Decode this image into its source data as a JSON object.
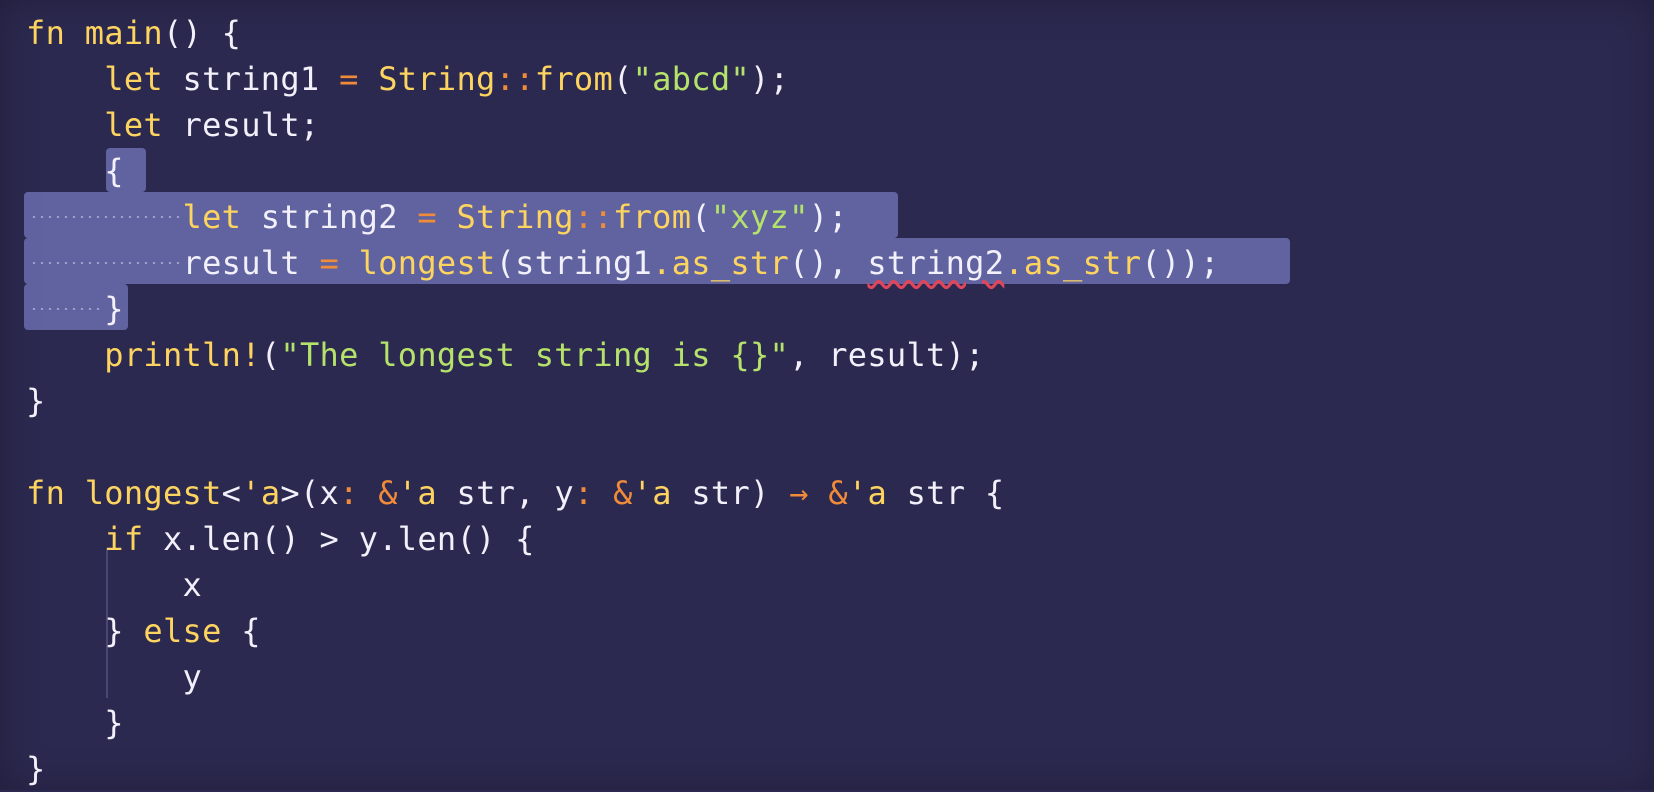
{
  "editor": {
    "theme": {
      "background": "#2c2950",
      "keyword": "#fdd45f",
      "string": "#b5e26b",
      "operator": "#f08b3a",
      "text": "#f2f0fa",
      "selection": "#6f73b6",
      "error_underline": "#e0465b"
    },
    "lines": [
      {
        "tokens": [
          {
            "t": "fn",
            "c": "kw"
          },
          {
            "t": " main",
            "c": "fn"
          },
          {
            "t": "() {",
            "c": "punc"
          }
        ]
      },
      {
        "tokens": [
          {
            "t": "    let",
            "c": "kw"
          },
          {
            "t": " string1 ",
            "c": "plain"
          },
          {
            "t": "=",
            "c": "op"
          },
          {
            "t": " String",
            "c": "ty"
          },
          {
            "t": "::",
            "c": "op"
          },
          {
            "t": "from",
            "c": "fn"
          },
          {
            "t": "(",
            "c": "punc"
          },
          {
            "t": "\"abcd\"",
            "c": "str"
          },
          {
            "t": ");",
            "c": "punc"
          }
        ]
      },
      {
        "tokens": [
          {
            "t": "    let",
            "c": "kw"
          },
          {
            "t": " result;",
            "c": "plain"
          }
        ]
      },
      {
        "tokens": [
          {
            "t": "    {",
            "c": "punc"
          }
        ]
      },
      {
        "tokens": [
          {
            "t": "        let",
            "c": "kw"
          },
          {
            "t": " string2 ",
            "c": "plain"
          },
          {
            "t": "=",
            "c": "op"
          },
          {
            "t": " String",
            "c": "ty"
          },
          {
            "t": "::",
            "c": "op"
          },
          {
            "t": "from",
            "c": "fn"
          },
          {
            "t": "(",
            "c": "punc"
          },
          {
            "t": "\"xyz\"",
            "c": "str"
          },
          {
            "t": ");",
            "c": "punc"
          }
        ]
      },
      {
        "tokens": [
          {
            "t": "        result ",
            "c": "plain"
          },
          {
            "t": "=",
            "c": "op"
          },
          {
            "t": " longest",
            "c": "fn"
          },
          {
            "t": "(string1",
            "c": "plain"
          },
          {
            "t": ".as_str",
            "c": "fn"
          },
          {
            "t": "(), ",
            "c": "punc"
          },
          {
            "t": "string2",
            "c": "err"
          },
          {
            "t": ".as_str",
            "c": "fn"
          },
          {
            "t": "());",
            "c": "punc"
          }
        ]
      },
      {
        "tokens": [
          {
            "t": "    }",
            "c": "punc"
          }
        ]
      },
      {
        "tokens": [
          {
            "t": "    println!",
            "c": "fn"
          },
          {
            "t": "(",
            "c": "punc"
          },
          {
            "t": "\"The longest string is {}\"",
            "c": "str"
          },
          {
            "t": ", result);",
            "c": "punc"
          }
        ]
      },
      {
        "tokens": [
          {
            "t": "}",
            "c": "punc"
          }
        ]
      },
      {
        "tokens": []
      },
      {
        "tokens": [
          {
            "t": "fn",
            "c": "kw"
          },
          {
            "t": " longest",
            "c": "fn"
          },
          {
            "t": "<",
            "c": "punc"
          },
          {
            "t": "'a",
            "c": "ty"
          },
          {
            "t": ">(x",
            "c": "plain"
          },
          {
            "t": ":",
            "c": "op"
          },
          {
            "t": " &",
            "c": "op"
          },
          {
            "t": "'a",
            "c": "ty"
          },
          {
            "t": " str, y",
            "c": "plain"
          },
          {
            "t": ":",
            "c": "op"
          },
          {
            "t": " &",
            "c": "op"
          },
          {
            "t": "'a",
            "c": "ty"
          },
          {
            "t": " str) ",
            "c": "plain"
          },
          {
            "t": "→",
            "c": "op"
          },
          {
            "t": " &",
            "c": "op"
          },
          {
            "t": "'a",
            "c": "ty"
          },
          {
            "t": " str {",
            "c": "plain"
          }
        ]
      },
      {
        "tokens": [
          {
            "t": "    if",
            "c": "kw"
          },
          {
            "t": " x.len() > y.len() {",
            "c": "plain"
          }
        ]
      },
      {
        "tokens": [
          {
            "t": "        x",
            "c": "plain"
          }
        ]
      },
      {
        "tokens": [
          {
            "t": "    }",
            "c": "punc"
          },
          {
            "t": " else",
            "c": "kw"
          },
          {
            "t": " {",
            "c": "punc"
          }
        ]
      },
      {
        "tokens": [
          {
            "t": "        y",
            "c": "plain"
          }
        ]
      },
      {
        "tokens": [
          {
            "t": "    }",
            "c": "punc"
          }
        ]
      },
      {
        "tokens": [
          {
            "t": "}",
            "c": "punc"
          }
        ]
      }
    ]
  }
}
